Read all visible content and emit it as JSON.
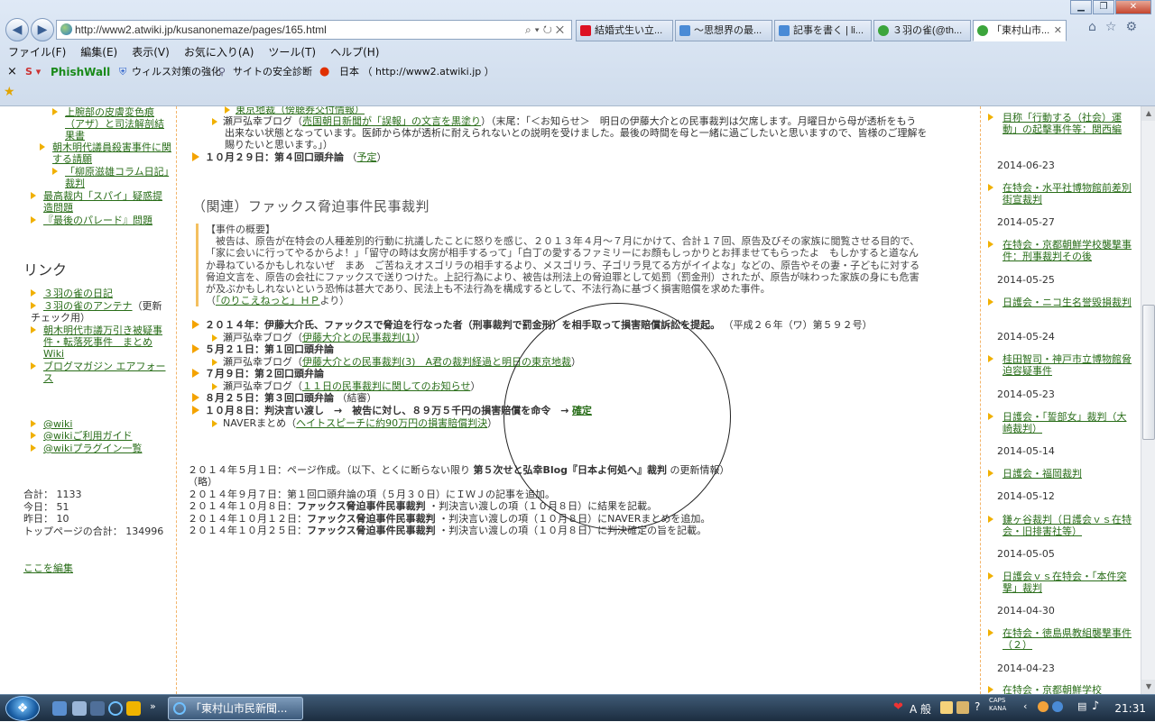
{
  "browser": {
    "url": "http://www2.atwiki.jp/kusanonemaze/pages/165.html",
    "tabs": [
      {
        "label": "結婚式生い立...",
        "icon_color": "#d12"
      },
      {
        "label": "～思想界の最...",
        "icon_color": "#4a8bd6"
      },
      {
        "label": "記事を書く | li...",
        "icon_color": "#4a8bd6"
      },
      {
        "label": "３羽の雀(@th...",
        "icon_color": "#3ca53c"
      },
      {
        "label": "「東村山市...",
        "icon_color": "#3ca53c"
      }
    ],
    "menu": [
      "ファイル(F)",
      "編集(E)",
      "表示(V)",
      "お気に入り(A)",
      "ツール(T)",
      "ヘルプ(H)"
    ],
    "toolbar": {
      "close": "×",
      "phishwall": "PhishWall",
      "virus": "ウィルス対策の強化",
      "security": "サイトの安全診断",
      "country": "日本 （ http://www2.atwiki.jp ）"
    }
  },
  "left_sidebar": {
    "items": [
      {
        "label": "上腕部の皮膚変色痕（アザ）と司法解剖結果書"
      },
      {
        "label": "朝木明代議員殺害事件に関する請願"
      },
      {
        "label": "「柳原滋雄コラム日記」裁判"
      },
      {
        "label": "最高裁内「スパイ」疑惑提造問題"
      },
      {
        "label": "『最後のパレード』問題"
      }
    ],
    "links_heading": "リンク",
    "links": [
      {
        "label": "３羽の雀の日記",
        "suffix": ""
      },
      {
        "label": "３羽の雀のアンテナ",
        "suffix": "（更新チェック用）"
      },
      {
        "label": "朝木明代市議万引き被疑事件・転落死事件　まとめWiki",
        "suffix": ""
      },
      {
        "label": "ブログマガジン エアフォース",
        "suffix": ""
      }
    ],
    "wiki_links": [
      "@wiki",
      "@wikiご利用ガイド",
      "@wikiプラグイン一覧"
    ],
    "stats": {
      "total_label": "合計：",
      "total": "1133",
      "today_label": "今日：",
      "today": "51",
      "yesterday_label": "昨日：",
      "yesterday": "10",
      "toppage_label": "トップページの合計：",
      "toppage": "134996"
    },
    "edit_link": "ここを編集"
  },
  "main": {
    "top_lines": {
      "partial": "東京地裁（傍聴券交付情報）",
      "blog_prefix": "瀬戸弘幸ブログ（",
      "blog_link": "売国朝日新聞が「誤報」の文言を黒塗り",
      "blog_suffix": "）（末尾：「＜お知らせ＞　明日の伊藤大介との民事裁判は欠席します。月曜日から母が透析をもう",
      "blog_line2": "出来ない状態となっています。医師から体が透析に耐えられないとの説明を受けました。最後の時間を母と一緒に過ごしたいと思いますので、皆様のご理解を",
      "blog_line3": "賜りたいと思います。」）",
      "oct29": "１０月２９日：第４回口頭弁論",
      "oct29_link": "予定"
    },
    "section_title": "（関連）ファックス脅迫事件民事裁判",
    "overview_heading": "【事件の概要】",
    "overview_lines": [
      "　被告は、原告が在特会の人種差別的行動に抗議したことに怒りを感じ、２０１３年４月～７月にかけて、合計１７回、原告及びその家族に閲覧させる目的で、",
      "「家に会いに行ってやるからよ！」「留守の時は女房が相手するって」「白丁の愛するファミリーにお顔もしっかりとお拝ませてもらったよ　もしかすると道なん",
      "か尋ねているかもしれないぜ　まあ　ご苦ねえオスゴリラの相手するより、メスゴリラ、子ゴリラ見てる方がイイよな」などの、原告やその妻・子どもに対する",
      "脅迫文言を、原告の会社にファックスで送りつけた。上記行為により、被告は刑法上の脅迫罪として処罰（罰金刑）されたが、原告が味わった家族の身にも危害",
      "が及ぶかもしれないという恐怖は甚大であり、民法上も不法行為を構成するとして、不法行為に基づく損害賠償を求めた事件。"
    ],
    "overview_source_link": "「のりこえねっと」ＨＰ",
    "overview_source_suffix": "より）",
    "timeline": {
      "e1": "２０１４年：伊藤大介氏、ファックスで脅迫を行なった者（刑事裁判で罰金刑）を相手取って損害賠償訴訟を提起。",
      "e1_note": "（平成２６年（ワ）第５９２号）",
      "e1_sub_prefix": "瀬戸弘幸ブログ（",
      "e1_sub_link": "伊藤大介との民事裁判(1)",
      "e2": "５月２１日：第１回口頭弁論",
      "e2_sub_link": "伊藤大介との民事裁判(3)　A君の裁判経過と明日の東京地裁",
      "e3": "７月９日：第２回口頭弁論",
      "e3_sub_link": "１１日の民事裁判に関してのお知らせ",
      "e4": "８月２５日：第３回口頭弁論",
      "e4_note": "（結審）",
      "e5": "１０月８日：判決言い渡し　→　被告に対し、８９万５千円の損害賠償を命令　→",
      "e5_link": "確定",
      "e5_sub_prefix": "NAVERまとめ（",
      "e5_sub_link": "ヘイトスピーチに約90万円の損害賠償判決"
    },
    "history": {
      "l1_a": "２０１４年５月１日：ページ作成。（以下、とくに断らない限り",
      "l1_b": "第５次せと弘幸Blog『日本よ何処へ』裁判",
      "l1_c": "の更新情報）",
      "l2": "（略）",
      "l3": "２０１４年９月７日：第１回口頭弁論の項（５月３０日）にＩＷＪの記事を追加。",
      "l4_a": "２０１４年１０月８日：",
      "l4_b": "ファックス脅迫事件民事裁判",
      "l4_c": "・判決言い渡しの項（１０月８日）に結果を記載。",
      "l5_a": "２０１４年１０月１２日：",
      "l5_b": "ファックス脅迫事件民事裁判",
      "l5_c": "・判決言い渡しの項（１０月８日）にNAVERまとめを追加。",
      "l6_a": "２０１４年１０月２５日：",
      "l6_b": "ファックス脅迫事件民事裁判",
      "l6_c": "・判決言い渡しの項（１０月８日）に判決確定の旨を記載。"
    }
  },
  "right_sidebar": {
    "entries": [
      {
        "date": "",
        "label": "目称「行動する（社会）運動」の起擊事件等：関西編"
      },
      {
        "date": "2014-06-23",
        "label": "在特会・水平社博物館前差別街宣裁判"
      },
      {
        "date": "2014-05-27",
        "label": "在特会・京都朝鮮学校襲撃事件：刑事裁判その後"
      },
      {
        "date": "2014-05-25",
        "label": "日護会・ニコ生名誉毀損裁判"
      },
      {
        "date": "2014-05-24",
        "label": "桂田智司・神戸市立博物館脅迫容疑事件"
      },
      {
        "date": "2014-05-23",
        "label": "日護会・「誓部女」裁判（大崎裁判）"
      },
      {
        "date": "2014-05-14",
        "label": "日護会・福岡裁判"
      },
      {
        "date": "2014-05-12",
        "label": "鎌ヶ谷裁判（日護会ｖｓ在特会・旧排害社等）"
      },
      {
        "date": "2014-05-05",
        "label": "日護会ｖｓ在特会・「本件突撃」裁判"
      },
      {
        "date": "2014-04-30",
        "label": "在特会・徳島県教組襲撃事件（２）"
      },
      {
        "date": "2014-04-23",
        "label": "在特会・京都朝鮮学校"
      }
    ]
  },
  "taskbar": {
    "task_label": "「東村山市民新聞...",
    "ime": "A 般",
    "caps": "CAPS",
    "kana": "KANA",
    "clock": "21:31"
  }
}
